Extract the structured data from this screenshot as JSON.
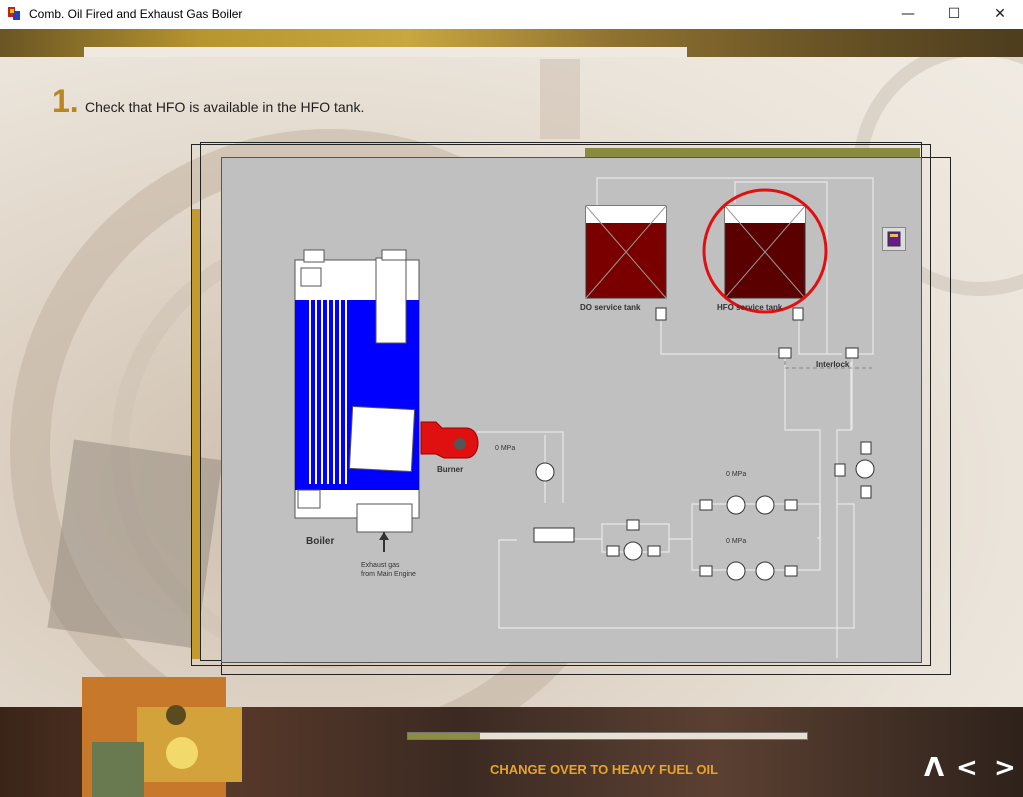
{
  "window": {
    "title": "Comb. Oil Fired and Exhaust Gas Boiler",
    "controls": {
      "minimize": "—",
      "maximize": "☐",
      "close": "✕"
    }
  },
  "step": {
    "number": "1.",
    "instruction": "Check that HFO is available in the HFO tank."
  },
  "diagram": {
    "labels": {
      "do_tank": "DO service tank",
      "hfo_tank": "HFO service tank",
      "interlock": "Interlock",
      "burner": "Burner",
      "boiler": "Boiler",
      "exhaust_line1": "Exhaust gas",
      "exhaust_line2": "from Main Engine",
      "pressure_burner": "0 MPa",
      "pressure_pump1": "0 MPa",
      "pressure_pump2": "0 MPa"
    },
    "colors": {
      "background": "#c0c0c0",
      "water": "#0000ff",
      "tank_oil": "#7a0000",
      "burner": "#e01010",
      "highlight": "#e01010"
    },
    "highlight": "HFO service tank"
  },
  "footer": {
    "title": "CHANGE OVER TO HEAVY FUEL OIL",
    "progress": 0.18,
    "nav": {
      "up": "ᐱ",
      "back": "<",
      "next": ">"
    }
  }
}
